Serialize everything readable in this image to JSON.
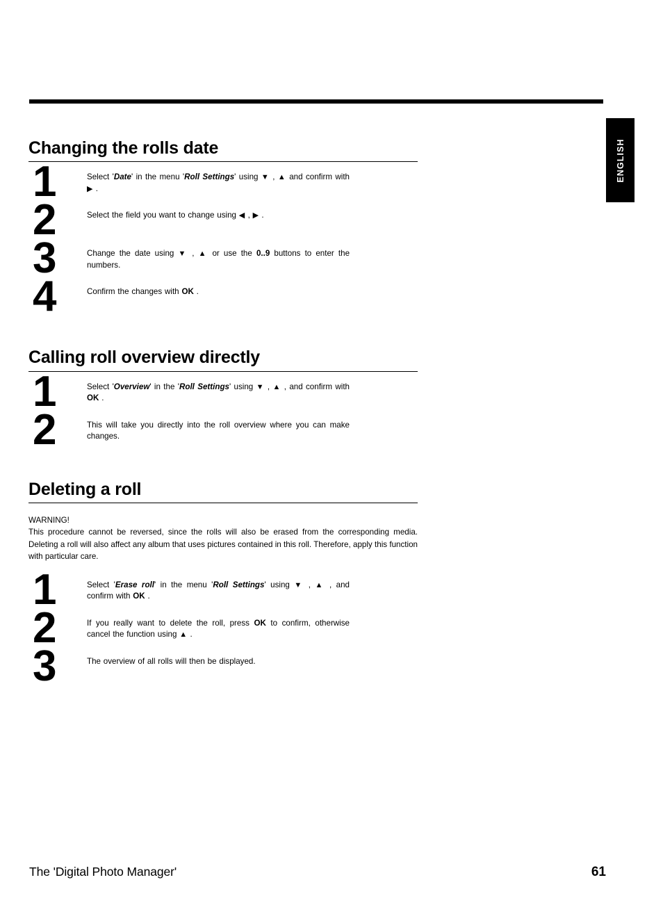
{
  "page": {
    "language_tab": "ENGLISH",
    "footer_title": "The 'Digital Photo Manager'",
    "page_number": "61",
    "accent_color": "#000000",
    "background_color": "#ffffff"
  },
  "sections": [
    {
      "heading": "Changing the rolls date",
      "steps": [
        {
          "number": "1",
          "parts": [
            {
              "t": "Select '",
              "s": "plain"
            },
            {
              "t": "Date",
              "s": "bold-italic"
            },
            {
              "t": "' in the menu '",
              "s": "plain"
            },
            {
              "t": "Roll Settings",
              "s": "bold-italic"
            },
            {
              "t": "' using ",
              "s": "plain"
            },
            {
              "t": "▼",
              "s": "glyph"
            },
            {
              "t": " , ",
              "s": "plain"
            },
            {
              "t": "▲",
              "s": "glyph"
            },
            {
              "t": " and confirm with ",
              "s": "plain"
            },
            {
              "t": "▶",
              "s": "glyph"
            },
            {
              "t": " .",
              "s": "plain"
            }
          ]
        },
        {
          "number": "2",
          "parts": [
            {
              "t": "Select the field you want to change using ",
              "s": "plain"
            },
            {
              "t": "◀",
              "s": "glyph"
            },
            {
              "t": " , ",
              "s": "plain"
            },
            {
              "t": "▶",
              "s": "glyph"
            },
            {
              "t": " .",
              "s": "plain"
            }
          ]
        },
        {
          "number": "3",
          "parts": [
            {
              "t": "Change the date using ",
              "s": "plain"
            },
            {
              "t": "▼",
              "s": "glyph"
            },
            {
              "t": " , ",
              "s": "plain"
            },
            {
              "t": "▲",
              "s": "glyph"
            },
            {
              "t": " or use the ",
              "s": "plain"
            },
            {
              "t": "0..9",
              "s": "bold"
            },
            {
              "t": " buttons to enter the numbers.",
              "s": "plain"
            }
          ]
        },
        {
          "number": "4",
          "parts": [
            {
              "t": "Confirm the changes with ",
              "s": "plain"
            },
            {
              "t": "OK",
              "s": "bold"
            },
            {
              "t": " .",
              "s": "plain"
            }
          ]
        }
      ]
    },
    {
      "heading": "Calling roll overview directly",
      "steps": [
        {
          "number": "1",
          "parts": [
            {
              "t": "Select '",
              "s": "plain"
            },
            {
              "t": "Overview",
              "s": "bold-italic"
            },
            {
              "t": "' in the '",
              "s": "plain"
            },
            {
              "t": "Roll Settings",
              "s": "bold-italic"
            },
            {
              "t": "' using ",
              "s": "plain"
            },
            {
              "t": "▼",
              "s": "glyph"
            },
            {
              "t": " , ",
              "s": "plain"
            },
            {
              "t": "▲",
              "s": "glyph"
            },
            {
              "t": " , and confirm with ",
              "s": "plain"
            },
            {
              "t": "OK",
              "s": "bold"
            },
            {
              "t": " .",
              "s": "plain"
            }
          ]
        },
        {
          "number": "2",
          "parts": [
            {
              "t": "This will take you directly into the roll overview where you can make changes.",
              "s": "plain"
            }
          ]
        }
      ]
    },
    {
      "heading": "Deleting a roll",
      "warning": {
        "title": "WARNING!",
        "body": "This procedure cannot be reversed, since the rolls will also be erased from the corresponding media. Deleting a roll will also affect any album that uses pictures contained in this roll. Therefore, apply this function with particular care."
      },
      "steps": [
        {
          "number": "1",
          "parts": [
            {
              "t": "Select '",
              "s": "plain"
            },
            {
              "t": "Erase roll",
              "s": "bold-italic"
            },
            {
              "t": "' in the menu '",
              "s": "plain"
            },
            {
              "t": "Roll Settings",
              "s": "bold-italic"
            },
            {
              "t": "' using ",
              "s": "plain"
            },
            {
              "t": "▼",
              "s": "glyph"
            },
            {
              "t": " , ",
              "s": "plain"
            },
            {
              "t": "▲",
              "s": "glyph"
            },
            {
              "t": " , and confirm with ",
              "s": "plain"
            },
            {
              "t": "OK",
              "s": "bold"
            },
            {
              "t": " .",
              "s": "plain"
            }
          ]
        },
        {
          "number": "2",
          "parts": [
            {
              "t": "If you really want to delete the roll, press ",
              "s": "plain"
            },
            {
              "t": "OK",
              "s": "bold"
            },
            {
              "t": " to confirm, otherwise cancel the function using ",
              "s": "plain"
            },
            {
              "t": "▲",
              "s": "glyph"
            },
            {
              "t": " .",
              "s": "plain"
            }
          ]
        },
        {
          "number": "3",
          "parts": [
            {
              "t": "The overview of all rolls will then be displayed.",
              "s": "plain"
            }
          ]
        }
      ]
    }
  ]
}
